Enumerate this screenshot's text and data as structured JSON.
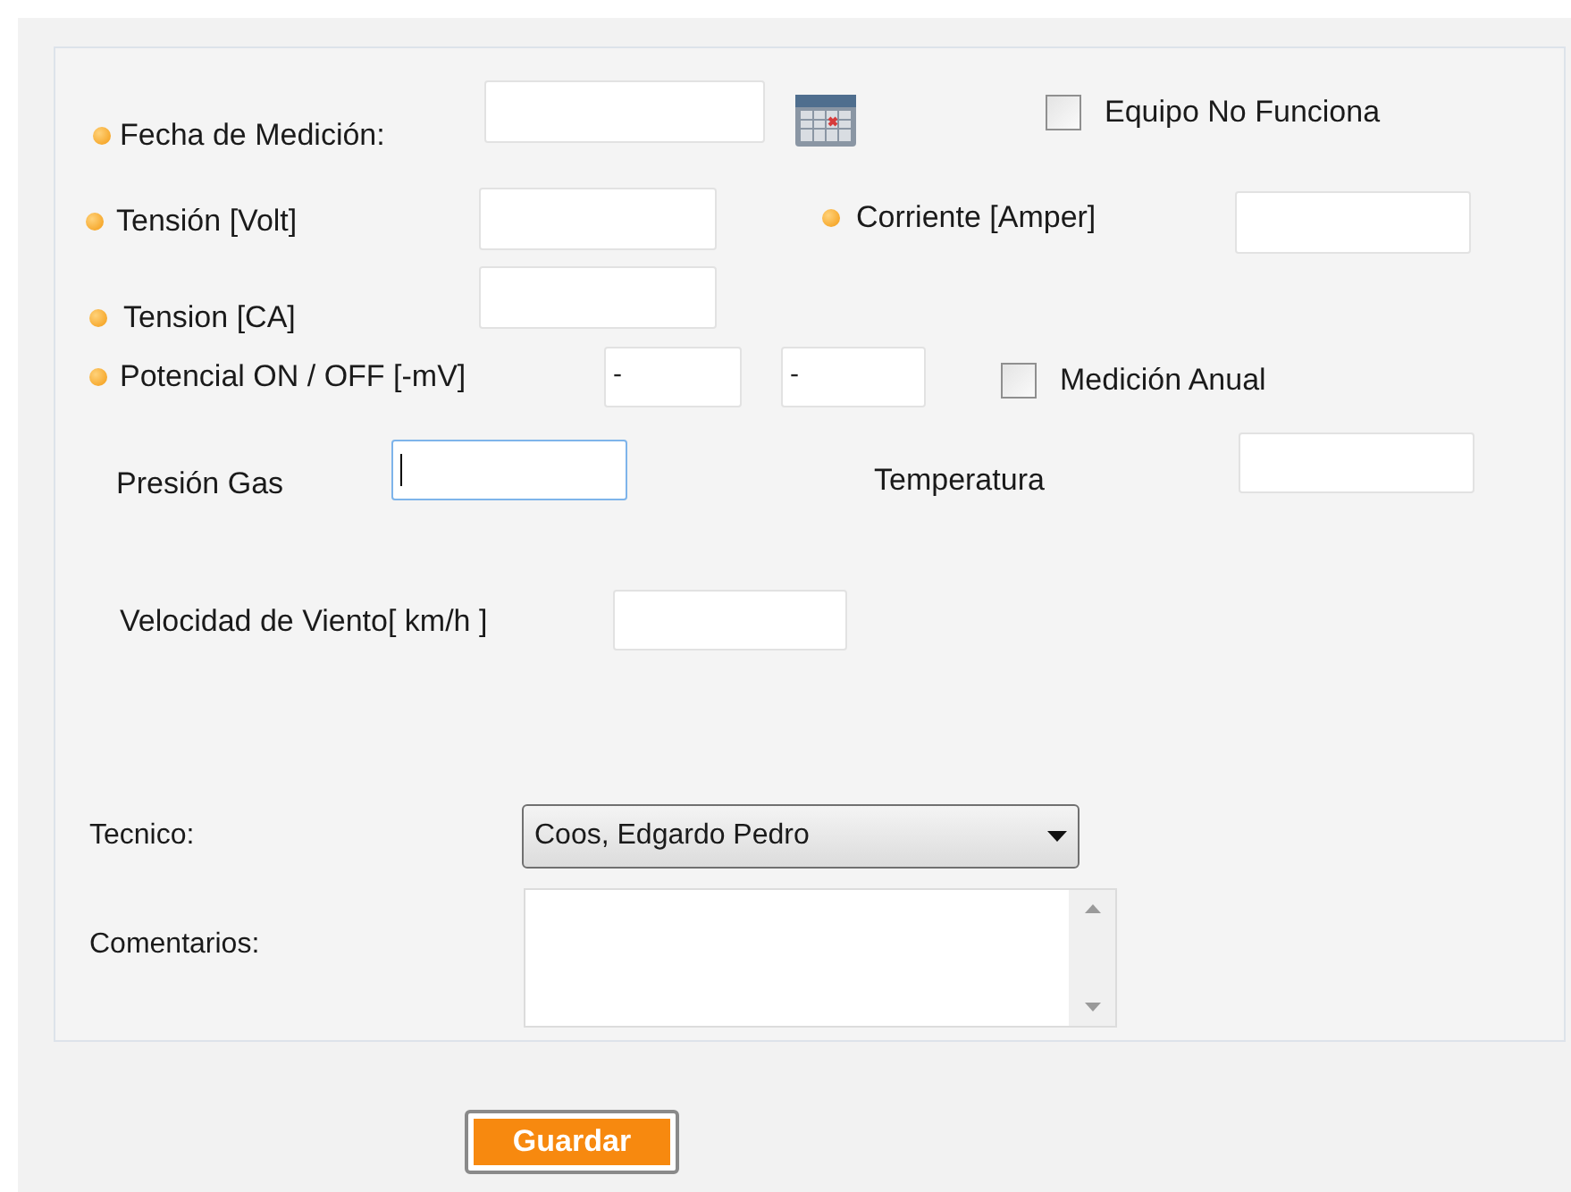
{
  "fecha": {
    "label": "Fecha de Medición:",
    "required": true
  },
  "equipo_no_funciona": {
    "label": "Equipo No Funciona",
    "checked": false
  },
  "tension_volt": {
    "label": "Tensión [Volt]",
    "required": true
  },
  "corriente": {
    "label": "Corriente [Amper]",
    "required": true
  },
  "tension_ca": {
    "label": "Tension [CA]",
    "required": true
  },
  "potencial": {
    "label": "Potencial ON / OFF [-mV]",
    "required": true,
    "on_value": "-",
    "off_value": "-"
  },
  "medicion_anual": {
    "label": "Medición Anual",
    "checked": false
  },
  "presion_gas": {
    "label": "Presión Gas",
    "focused": true
  },
  "temperatura": {
    "label": "Temperatura"
  },
  "velocidad_viento": {
    "label": "Velocidad de Viento[ km/h ]"
  },
  "tecnico": {
    "label": "Tecnico:",
    "value": "Coos, Edgardo Pedro"
  },
  "comentarios": {
    "label": "Comentarios:"
  },
  "save_button": "Guardar"
}
